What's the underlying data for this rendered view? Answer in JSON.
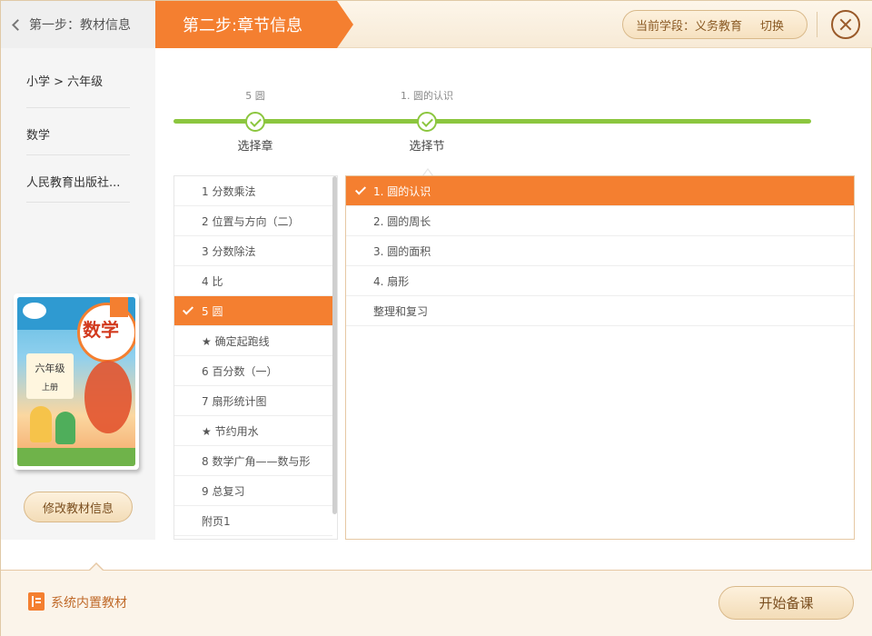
{
  "header": {
    "back_label": "第一步：教材信息",
    "step_title": "第二步:章节信息",
    "stage_label": "当前学段：义务教育",
    "switch_label": "切换"
  },
  "sidebar": {
    "level": "小学 > 六年级",
    "subject": "数学",
    "publisher": "人民教育出版社...",
    "book_title": "数学",
    "book_grade": "六年级",
    "book_volume": "上册",
    "modify_label": "修改教材信息"
  },
  "progress": {
    "chapter_selected": "5 圆",
    "chapter_label": "选择章",
    "section_selected": "1. 圆的认识",
    "section_label": "选择节",
    "color": "#8cc63f"
  },
  "chapters": [
    {
      "label": "1 分数乘法",
      "active": false
    },
    {
      "label": "2 位置与方向（二）",
      "active": false
    },
    {
      "label": "3 分数除法",
      "active": false
    },
    {
      "label": "4 比",
      "active": false
    },
    {
      "label": "5 圆",
      "active": true
    },
    {
      "label": "★ 确定起跑线",
      "active": false
    },
    {
      "label": "6 百分数（一）",
      "active": false
    },
    {
      "label": "7 扇形统计图",
      "active": false
    },
    {
      "label": "★ 节约用水",
      "active": false
    },
    {
      "label": "8 数学广角——数与形",
      "active": false
    },
    {
      "label": "9 总复习",
      "active": false
    },
    {
      "label": "附页1",
      "active": false
    }
  ],
  "sections": [
    {
      "label": "1. 圆的认识",
      "active": true
    },
    {
      "label": "2. 圆的周长",
      "active": false
    },
    {
      "label": "3. 圆的面积",
      "active": false
    },
    {
      "label": "4. 扇形",
      "active": false
    },
    {
      "label": "整理和复习",
      "active": false
    }
  ],
  "footer": {
    "builtin_label": "系统内置教材",
    "start_label": "开始备课"
  },
  "colors": {
    "accent": "#f47f30",
    "progress": "#8cc63f"
  }
}
